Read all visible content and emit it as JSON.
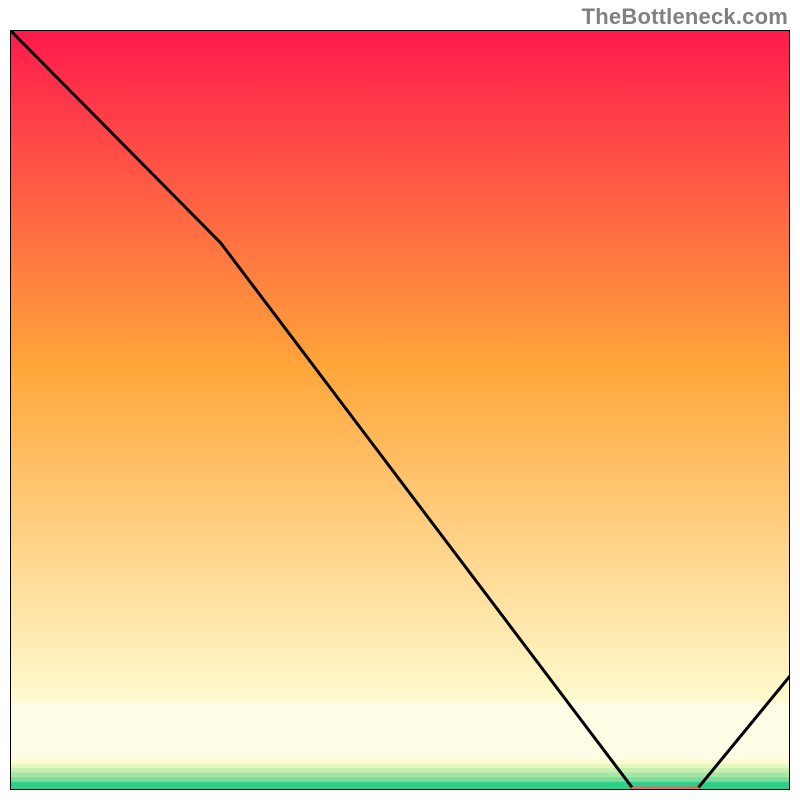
{
  "attribution": "TheBottleneck.com",
  "chart_data": {
    "type": "line",
    "title": "",
    "xlabel": "",
    "ylabel": "",
    "xlim": [
      0,
      100
    ],
    "ylim": [
      0,
      100
    ],
    "grid": false,
    "series": [
      {
        "name": "curve",
        "x": [
          0,
          27,
          80,
          88,
          100
        ],
        "y": [
          100,
          72,
          0,
          0,
          15
        ]
      }
    ],
    "special_segment": {
      "x0": 80,
      "x1": 88,
      "color": "#e36a66"
    },
    "gradient_bands": [
      {
        "y0": 100,
        "y1": 11.5,
        "from": "#ff1a4d",
        "to": "#fffbcf"
      },
      {
        "y0": 11.5,
        "y1": 4.0,
        "color": "#fffde6"
      },
      {
        "y0": 4.0,
        "y1": 3.4,
        "color": "#fdfcd0"
      },
      {
        "y0": 3.4,
        "y1": 2.9,
        "color": "#e6f5ba"
      },
      {
        "y0": 2.9,
        "y1": 2.3,
        "color": "#c8eeb1"
      },
      {
        "y0": 2.3,
        "y1": 1.7,
        "color": "#a4e6a6"
      },
      {
        "y0": 1.7,
        "y1": 1.1,
        "color": "#7edc9d"
      },
      {
        "y0": 1.1,
        "y1": 0.0,
        "color": "#2ecf8a"
      }
    ],
    "border_color": "#000000",
    "curve_color": "#000000"
  }
}
